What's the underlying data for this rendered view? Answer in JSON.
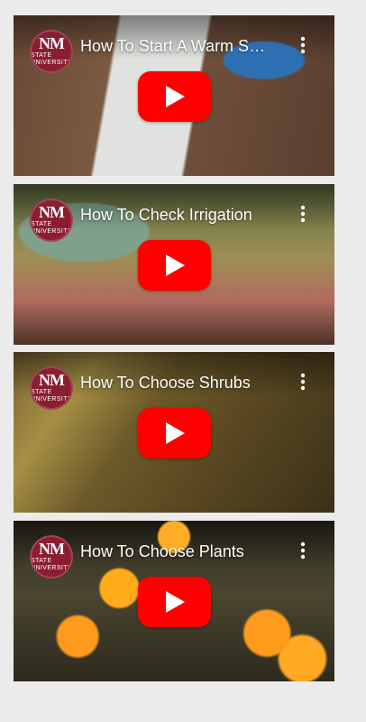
{
  "videos": [
    {
      "title": "How To Start A Warm Season Garden",
      "channel_logo": {
        "main": "NM",
        "sub": "STATE UNIVERSITY"
      },
      "more_icon": "more-vert-icon",
      "play_icon": "play-icon"
    },
    {
      "title": "How To Check Irrigation",
      "channel_logo": {
        "main": "NM",
        "sub": "STATE UNIVERSITY"
      },
      "more_icon": "more-vert-icon",
      "play_icon": "play-icon"
    },
    {
      "title": "How To Choose Shrubs",
      "channel_logo": {
        "main": "NM",
        "sub": "STATE UNIVERSITY"
      },
      "more_icon": "more-vert-icon",
      "play_icon": "play-icon"
    },
    {
      "title": "How To Choose Plants",
      "channel_logo": {
        "main": "NM",
        "sub": "STATE UNIVERSITY"
      },
      "more_icon": "more-vert-icon",
      "play_icon": "play-icon"
    }
  ],
  "colors": {
    "background": "#ebebeb",
    "youtube_red": "#ff0000",
    "nmsu_crimson": "#8a1e30",
    "white": "#ffffff"
  }
}
